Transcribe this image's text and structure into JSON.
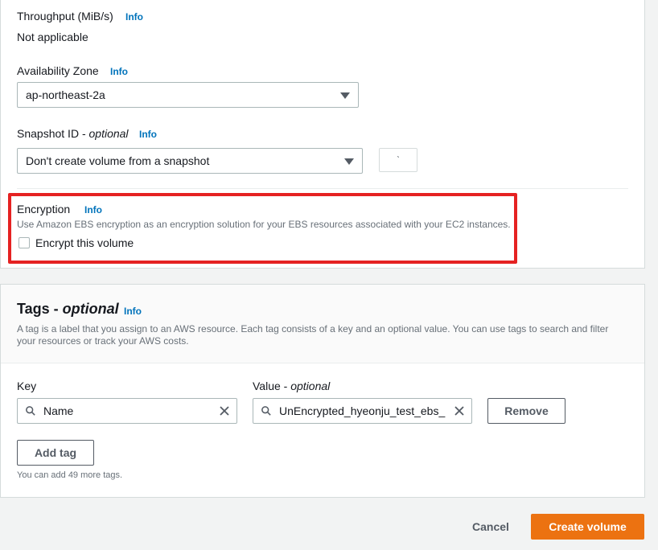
{
  "volume_settings": {
    "throughput": {
      "label": "Throughput (MiB/s)",
      "info": "Info",
      "value": "Not applicable"
    },
    "availability_zone": {
      "label": "Availability Zone",
      "info": "Info",
      "selected": "ap-northeast-2a"
    },
    "snapshot": {
      "label": "Snapshot ID - ",
      "label_optional": "optional",
      "info": "Info",
      "selected": "Don't create volume from a snapshot"
    },
    "encryption": {
      "label": "Encryption",
      "info": "Info",
      "description": "Use Amazon EBS encryption as an encryption solution for your EBS resources associated with your EC2 instances.",
      "checkbox_label": "Encrypt this volume",
      "checked": false
    }
  },
  "tags": {
    "title": "Tags - ",
    "title_optional": "optional",
    "info": "Info",
    "description_line1": "A tag is a label that you assign to an AWS resource. Each tag consists of a key and an optional value. You can use tags to search and filter",
    "description_line2": "your resources or track your AWS costs.",
    "key_label": "Key",
    "value_label": "Value - ",
    "value_label_optional": "optional",
    "rows": [
      {
        "key": "Name",
        "value": "UnEncrypted_hyeonju_test_ebs_"
      }
    ],
    "remove_label": "Remove",
    "add_tag_label": "Add tag",
    "remaining_note": "You can add 49 more tags."
  },
  "footer": {
    "cancel_label": "Cancel",
    "create_label": "Create volume"
  },
  "colors": {
    "accent": "#ec7211",
    "link": "#0073bb",
    "highlight": "#e52222"
  }
}
